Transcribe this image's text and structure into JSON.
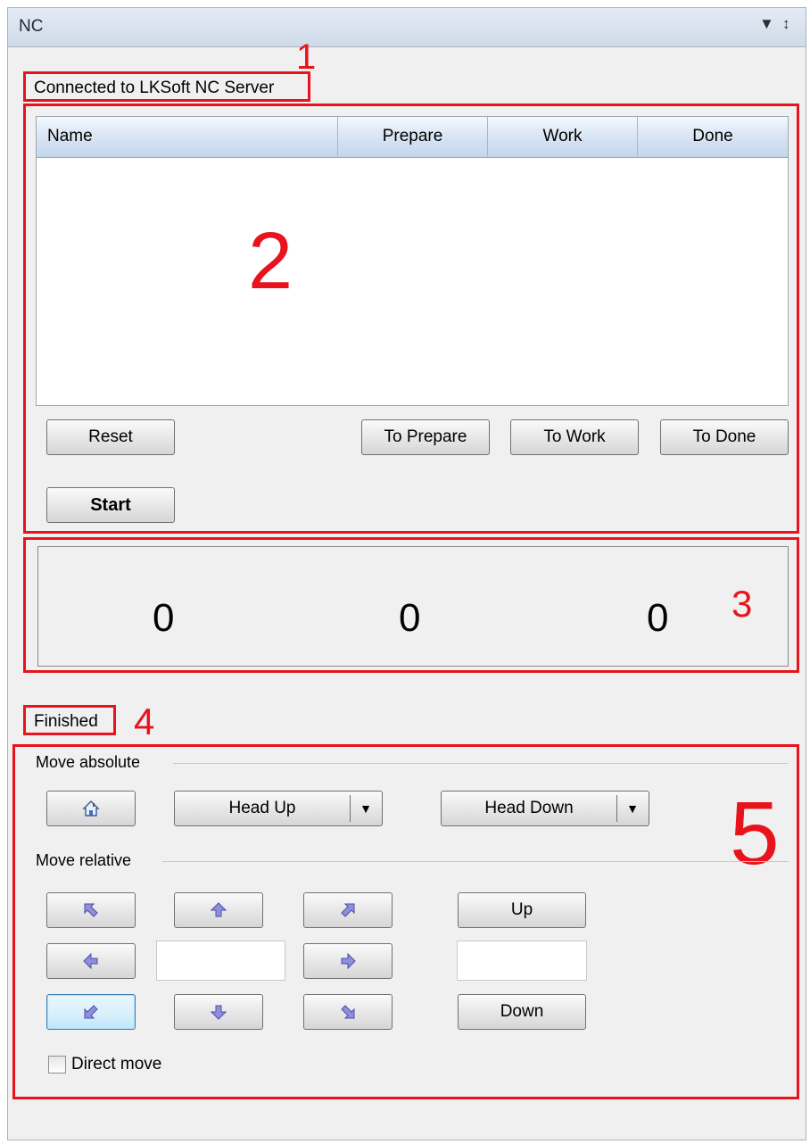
{
  "panel": {
    "title": "NC"
  },
  "status": {
    "connection": "Connected to LKSoft NC Server",
    "run_state": "Finished"
  },
  "job_table": {
    "columns": [
      "Name",
      "Prepare",
      "Work",
      "Done"
    ],
    "rows": []
  },
  "job_buttons": {
    "reset": "Reset",
    "to_prepare": "To Prepare",
    "to_work": "To Work",
    "to_done": "To Done",
    "start": "Start"
  },
  "counters": [
    "0",
    "0",
    "0"
  ],
  "move_absolute": {
    "label": "Move absolute",
    "home_icon": "home-icon",
    "head_up": "Head Up",
    "head_down": "Head Down"
  },
  "move_relative": {
    "label": "Move relative",
    "up": "Up",
    "down": "Down",
    "step_value": "",
    "z_value": ""
  },
  "direct_move": {
    "label": "Direct move",
    "checked": false
  },
  "annotations": [
    "1",
    "2",
    "3",
    "4",
    "5"
  ],
  "colors": {
    "annotation": "#e8131c",
    "header_blue": "#c4d6ec"
  }
}
